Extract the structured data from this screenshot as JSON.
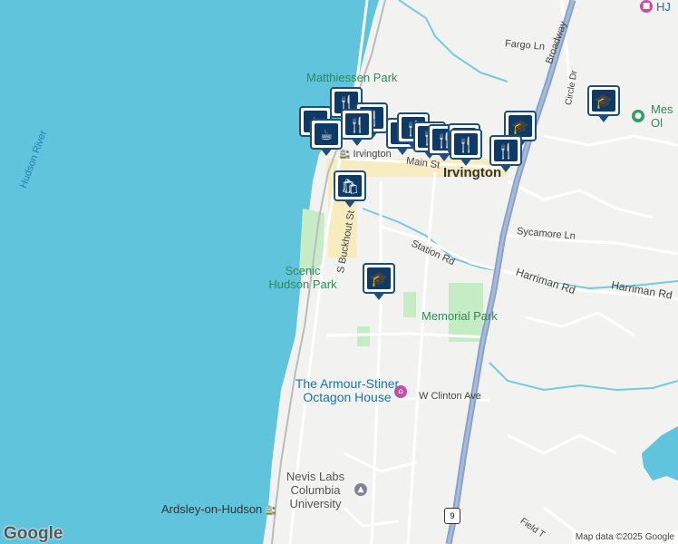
{
  "map": {
    "water_color": "#5fc4dc",
    "land_color": "#f2f2f0",
    "park_color": "#c6ecc6",
    "road_color": "#ffffff",
    "highway_color": "#8aa1c8",
    "stream_color": "#73cbe0"
  },
  "labels": {
    "hudson_river": "Hudson River",
    "matthiessen_park": "Matthiessen Park",
    "scenic_hudson_park": "Scenic Hudson Park",
    "irvington_station": "Irvington",
    "irvington_town": "Irvington",
    "main_st": "Main St",
    "s_buckhout_st": "S Buckhout St",
    "station_rd": "Station Rd",
    "sycamore_ln": "Sycamore Ln",
    "harriman_rd_1": "Harriman Rd",
    "harriman_rd_2": "Harriman Rd",
    "memorial_park": "Memorial Park",
    "armour_stiner": "The Armour-Stiner Octagon House",
    "w_clinton_ave": "W Clinton Ave",
    "nevis_labs": "Nevis Labs Columbia University",
    "ardsley_on_hudson": "Ardsley-on-Hudson",
    "fargo_ln": "Fargo Ln",
    "broadway": "Broadway",
    "circle_dr": "Circle Dr",
    "field_terrace": "Field T",
    "hj": "HJ",
    "mes_ol": "Mes Ol",
    "route_9": "9"
  },
  "markers": [
    {
      "type": "restaurant",
      "icon": "fork-knife-icon"
    },
    {
      "type": "restaurant",
      "icon": "fork-knife-icon"
    },
    {
      "type": "restaurant",
      "icon": "fork-knife-icon"
    },
    {
      "type": "cafe",
      "icon": "coffee-cup-icon"
    },
    {
      "type": "cafe",
      "icon": "coffee-cup-icon"
    },
    {
      "type": "restaurant",
      "icon": "fork-knife-icon"
    },
    {
      "type": "restaurant",
      "icon": "fork-knife-icon"
    },
    {
      "type": "restaurant",
      "icon": "fork-knife-icon"
    },
    {
      "type": "restaurant",
      "icon": "fork-knife-icon"
    },
    {
      "type": "school",
      "icon": "graduation-cap-icon"
    },
    {
      "type": "school",
      "icon": "graduation-cap-icon"
    },
    {
      "type": "restaurant",
      "icon": "fork-knife-icon"
    },
    {
      "type": "shopping",
      "icon": "shopping-bag-icon"
    },
    {
      "type": "school",
      "icon": "graduation-cap-icon"
    },
    {
      "type": "restaurant",
      "icon": "fork-knife-icon"
    },
    {
      "type": "school",
      "icon": "graduation-cap-icon"
    }
  ],
  "footer": {
    "logo": "Google",
    "attribution": "Map data ©2025 Google"
  }
}
